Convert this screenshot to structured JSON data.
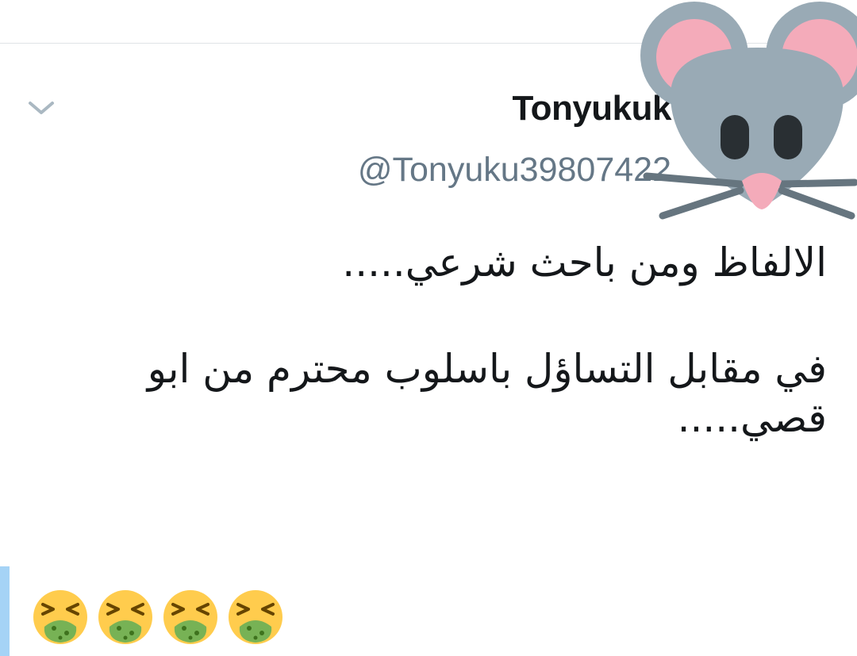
{
  "tweet": {
    "author": {
      "display_name": "Tonyukuk",
      "handle": "@Tonyuku39807422",
      "avatar_icon": "mouse-face-icon"
    },
    "menu_icon": "chevron-down-icon",
    "text_lines": [
      "الالفاظ ومن باحث شرعي.....",
      "",
      "في مقابل التساؤل باسلوب محترم من ابو",
      "قصي....."
    ],
    "emojis": [
      "face-vomiting-icon",
      "face-vomiting-icon",
      "face-vomiting-icon",
      "face-vomiting-icon"
    ]
  },
  "colors": {
    "text_primary": "#14171a",
    "text_secondary": "#657786",
    "divider": "#dfe3e6",
    "thread_bar": "#a5d3f6",
    "chevron": "#aab8c2"
  }
}
